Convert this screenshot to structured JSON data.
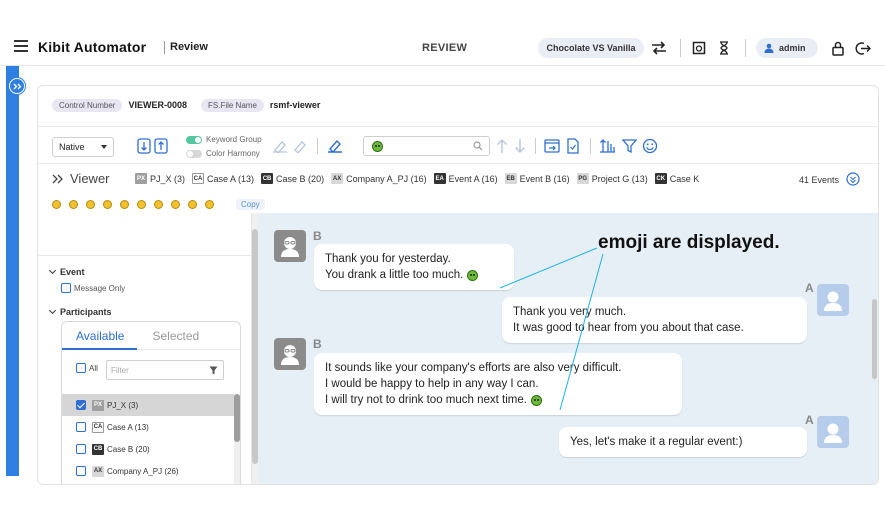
{
  "header": {
    "brand": "Kibit Automator",
    "brand_sub": "Review",
    "mode_title": "REVIEW",
    "project": "Chocolate VS Vanilla",
    "user": "admin"
  },
  "meta": {
    "control_number_label": "Control Number",
    "control_number_value": "VIEWER-0008",
    "file_name_label": "FS.File Name",
    "file_name_value": "rsmf-viewer"
  },
  "toolbar": {
    "native_select": "Native",
    "keyword_group": "Keyword Group",
    "color_harmony": "Color Harmony"
  },
  "viewer": {
    "title": "Viewer",
    "chips": [
      {
        "badge": "PX",
        "label": "PJ_X (3)",
        "style": "b-grey"
      },
      {
        "badge": "CA",
        "label": "Case A (13)",
        "style": "b-white"
      },
      {
        "badge": "CB",
        "label": "Case B (20)",
        "style": "b-dark"
      },
      {
        "badge": "AX",
        "label": "Company A_PJ (16)",
        "style": "b-light"
      },
      {
        "badge": "EA",
        "label": "Event A (16)",
        "style": "b-dark"
      },
      {
        "badge": "EB",
        "label": "Event B (16)",
        "style": "b-light"
      },
      {
        "badge": "PG",
        "label": "Project G (13)",
        "style": "b-light"
      },
      {
        "badge": "CK",
        "label": "Case K",
        "style": "b-dark"
      }
    ],
    "event_count": "41 Events",
    "copy_label": "Copy"
  },
  "left": {
    "event_label": "Event",
    "message_only": "Message Only",
    "participants_label": "Participants",
    "tab_available": "Available",
    "tab_selected": "Selected",
    "all_label": "All",
    "filter_placeholder": "Filter",
    "participants": [
      {
        "badge": "PX",
        "label": "PJ_X (3)",
        "checked": true,
        "style": "b-grey"
      },
      {
        "badge": "CA",
        "label": "Case A (13)",
        "checked": false,
        "style": "b-white"
      },
      {
        "badge": "CB",
        "label": "Case B (20)",
        "checked": false,
        "style": "b-dark"
      },
      {
        "badge": "AX",
        "label": "Company A_PJ (26)",
        "checked": false,
        "style": "b-light"
      }
    ]
  },
  "messages": [
    {
      "sender": "B",
      "lines": [
        "Thank you for yesterday.",
        "You drank a little too much."
      ]
    },
    {
      "sender": "A",
      "lines": [
        "Thank you very much.",
        "It was good to hear from you about that case."
      ]
    },
    {
      "sender": "B",
      "lines": [
        "It sounds like your company's efforts are also very difficult.",
        "I would be happy to help in any way I can.",
        "I will try not to drink too much next time."
      ]
    },
    {
      "sender": "A",
      "lines": [
        "Yes, let's make it a regular event:)"
      ]
    }
  ],
  "callout": "emoji are displayed."
}
